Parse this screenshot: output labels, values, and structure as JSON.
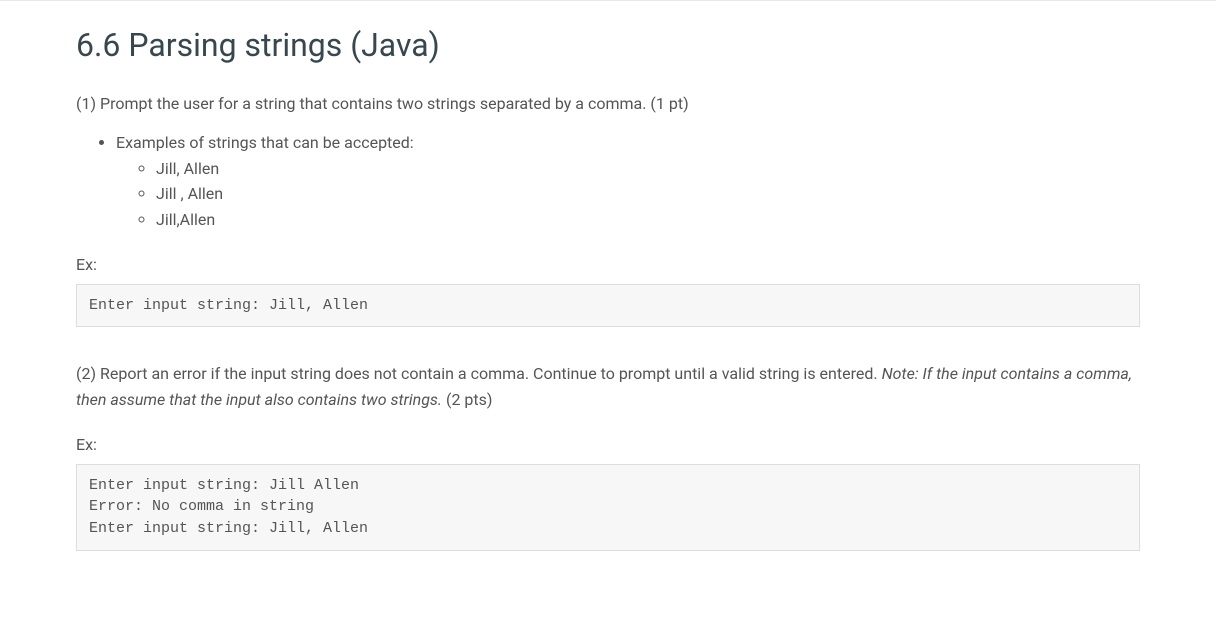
{
  "heading": "6.6 Parsing strings (Java)",
  "step1": {
    "text": "(1) Prompt the user for a string that contains two strings separated by a comma. (1 pt)",
    "examples_label": "Examples of strings that can be accepted:",
    "examples": [
      "Jill, Allen",
      "Jill , Allen",
      "Jill,Allen"
    ],
    "ex_label": "Ex:",
    "code": "Enter input string: Jill, Allen"
  },
  "step2": {
    "text_before": "(2) Report an error if the input string does not contain a comma. Continue to prompt until a valid string is entered. ",
    "note_italic": "Note: If the input contains a comma, then assume that the input also contains two strings.",
    "text_after": " (2 pts)",
    "ex_label": "Ex:",
    "code": "Enter input string: Jill Allen\nError: No comma in string\nEnter input string: Jill, Allen"
  }
}
